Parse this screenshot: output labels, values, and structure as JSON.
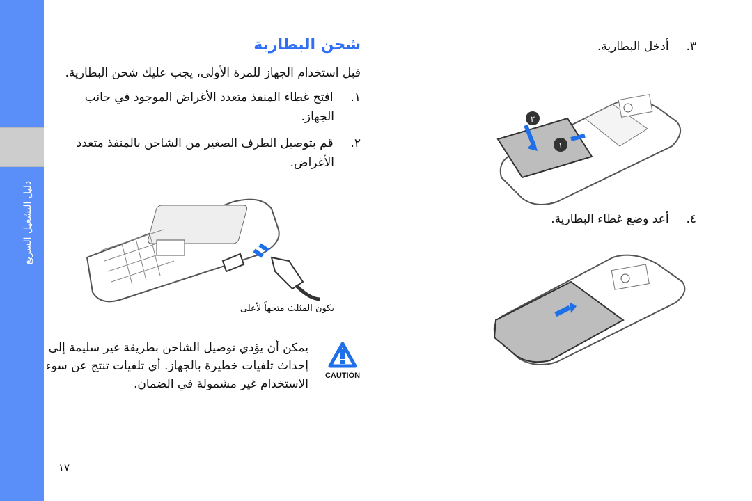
{
  "sidebar": {
    "label": "دليل التشغيل السريع",
    "color": "#5a8ef8"
  },
  "section": {
    "title": "شحن البطارية",
    "intro": "قبل استخدام الجهاز للمرة الأولى، يجب عليك شحن البطارية.",
    "steps": [
      {
        "num": "١.",
        "lines": [
          "افتح غطاء المنفذ متعدد الأغراض الموجود في جانب",
          "الجهاز."
        ]
      },
      {
        "num": "٢.",
        "lines": [
          "قم بتوصيل الطرف الصغير من الشاحن بالمنفذ متعدد",
          "الأغراض."
        ]
      }
    ],
    "figure_caption": "يكون المثلث متجهاً لأعلى",
    "caution": {
      "label": "CAUTION",
      "icon": "warning-triangle-icon",
      "lines": [
        "يمكن أن يؤدي توصيل الشاحن بطريقة غير سليمة إلى",
        "إحداث تلفيات خطيرة بالجهاز. أي تلفيات تنتج عن سوء",
        "الاستخدام غير مشمولة في الضمان."
      ]
    }
  },
  "right": {
    "step3": {
      "num": "٣.",
      "text": "أدخل البطارية."
    },
    "step4": {
      "num": "٤.",
      "text": "أعد وضع غطاء البطارية."
    },
    "badges": [
      "١",
      "٢"
    ]
  },
  "page_number": "١٧",
  "accent": "#2f6ff5"
}
